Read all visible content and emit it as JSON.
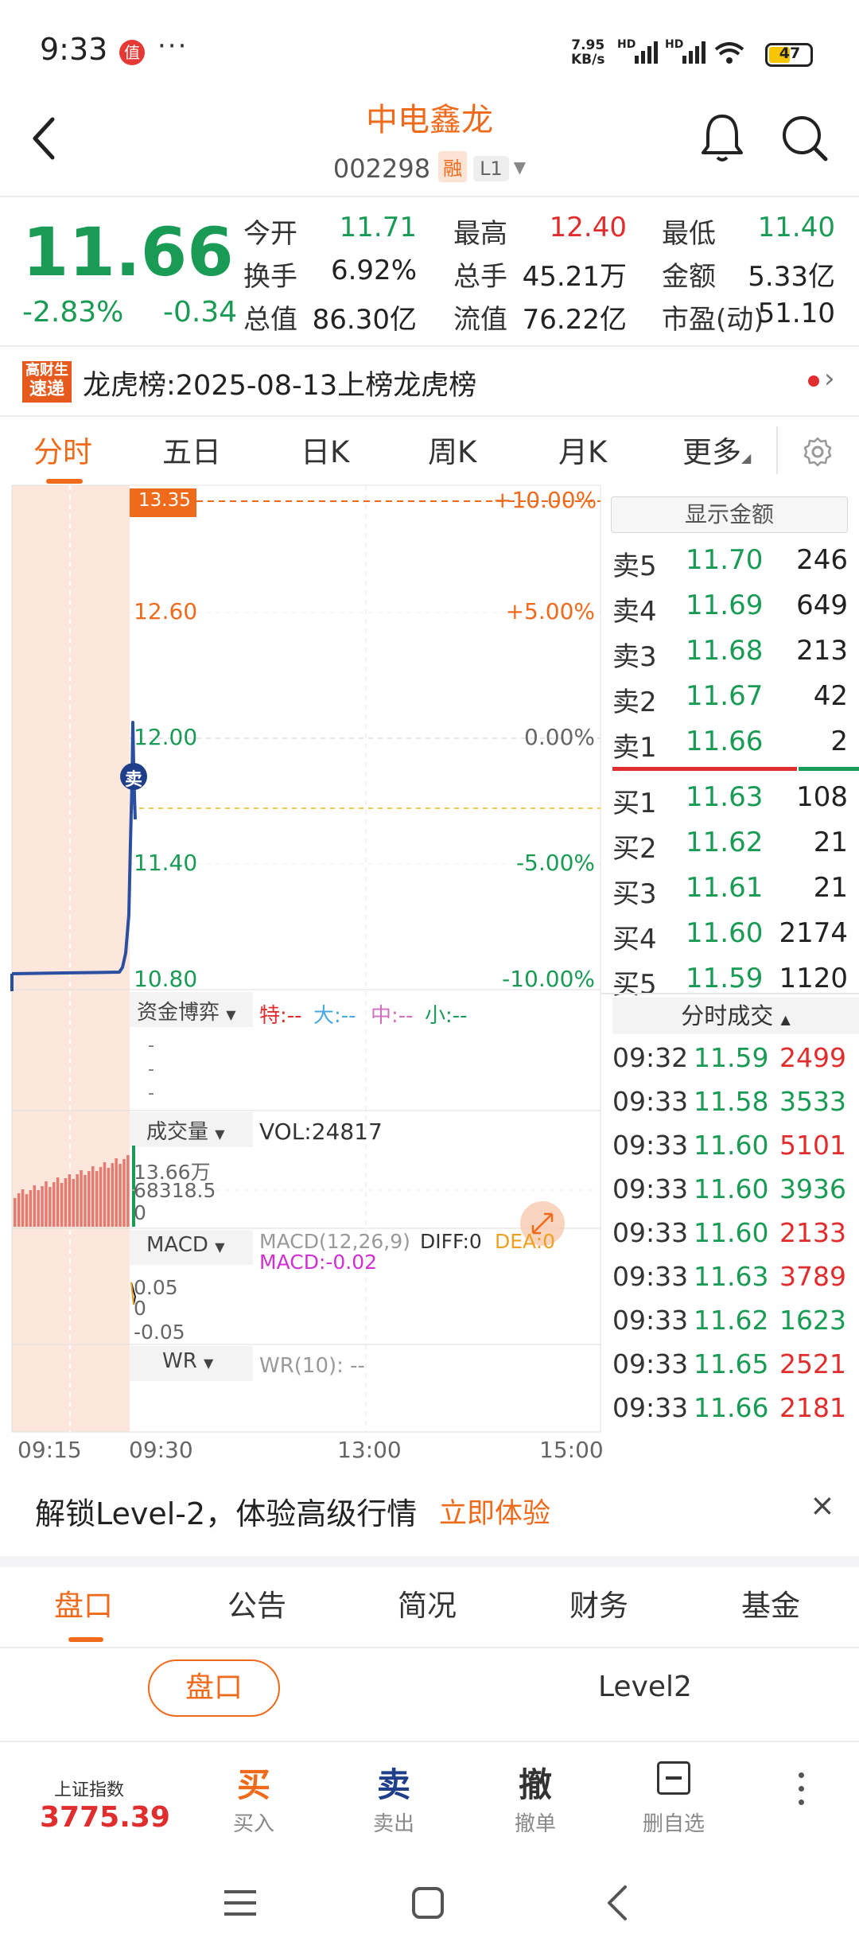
{
  "status_bar": {
    "time": "9:33",
    "badge": "值",
    "dots": "···",
    "net_speed_1": "7.95",
    "net_speed_2": "KB/s",
    "battery": "47"
  },
  "header": {
    "stock_name": "中电鑫龙",
    "stock_code": "002298",
    "tag_margin": "融",
    "tag_level": "L1"
  },
  "quote": {
    "last_price": "11.66",
    "change_pct": "-2.83%",
    "change_val": "-0.34",
    "fields": [
      {
        "label": "今开",
        "value": "11.71",
        "color": "#1a9b55"
      },
      {
        "label": "最高",
        "value": "12.40",
        "color": "#e02d2d"
      },
      {
        "label": "最低",
        "value": "11.40",
        "color": "#1a9b55"
      },
      {
        "label": "换手",
        "value": "6.92%",
        "color": "#222222"
      },
      {
        "label": "总手",
        "value": "45.21万",
        "color": "#222222"
      },
      {
        "label": "金额",
        "value": "5.33亿",
        "color": "#222222"
      },
      {
        "label": "总值",
        "value": "86.30亿",
        "color": "#222222"
      },
      {
        "label": "流值",
        "value": "76.22亿",
        "color": "#222222"
      },
      {
        "label": "市盈(动)",
        "value": "51.10",
        "color": "#222222"
      }
    ]
  },
  "news": {
    "logo_line1": "高财生",
    "logo_line2": "速递",
    "text": "龙虎榜:2025-08-13上榜龙虎榜"
  },
  "period_tabs": [
    "分时",
    "五日",
    "日K",
    "周K",
    "月K",
    "更多"
  ],
  "chart": {
    "price_labels_left": [
      "13.35",
      "12.60",
      "12.00",
      "11.40",
      "10.80"
    ],
    "pct_labels_right": [
      "+10.00%",
      "+5.00%",
      "0.00%",
      "-5.00%",
      "-10.00%"
    ],
    "sell_marker": "卖",
    "fund_panel": {
      "title": "资金博弈",
      "legend_te": "特:--",
      "legend_da": "大:--",
      "legend_zhong": "中:--",
      "legend_xiao": "小:--",
      "dash": "-"
    },
    "volume_panel": {
      "title": "成交量",
      "vol_text": "VOL:24817",
      "axis_top": "13.66万",
      "axis_mid": "68318.5",
      "axis_zero": "0"
    },
    "macd_panel": {
      "title": "MACD",
      "params": "MACD(12,26,9)",
      "diff": "DIFF:0",
      "dea": "DEA:0",
      "macd": "MACD:-0.02",
      "axis_top": "0.05",
      "axis_mid": "0",
      "axis_bottom": "-0.05"
    },
    "wr_panel": {
      "title": "WR",
      "wr_text": "WR(10): --"
    },
    "time_labels": [
      "09:15",
      "09:30",
      "13:00",
      "15:00"
    ]
  },
  "orderbook": {
    "show_amount_label": "显示金额",
    "asks": [
      {
        "label": "卖5",
        "price": "11.70",
        "volume": "246"
      },
      {
        "label": "卖4",
        "price": "11.69",
        "volume": "649"
      },
      {
        "label": "卖3",
        "price": "11.68",
        "volume": "213"
      },
      {
        "label": "卖2",
        "price": "11.67",
        "volume": "42"
      },
      {
        "label": "卖1",
        "price": "11.66",
        "volume": "2"
      }
    ],
    "bids": [
      {
        "label": "买1",
        "price": "11.63",
        "volume": "108"
      },
      {
        "label": "买2",
        "price": "11.62",
        "volume": "21"
      },
      {
        "label": "买3",
        "price": "11.61",
        "volume": "21"
      },
      {
        "label": "买4",
        "price": "11.60",
        "volume": "2174"
      },
      {
        "label": "买5",
        "price": "11.59",
        "volume": "1120"
      }
    ]
  },
  "ticks": {
    "header": "分时成交",
    "rows": [
      {
        "time": "09:32",
        "price": "11.59",
        "volume": "2499",
        "color": "#e02d2d"
      },
      {
        "time": "09:33",
        "price": "11.58",
        "volume": "3533",
        "color": "#1a9b55"
      },
      {
        "time": "09:33",
        "price": "11.60",
        "volume": "5101",
        "color": "#e02d2d"
      },
      {
        "time": "09:33",
        "price": "11.60",
        "volume": "3936",
        "color": "#1a9b55"
      },
      {
        "time": "09:33",
        "price": "11.60",
        "volume": "2133",
        "color": "#e02d2d"
      },
      {
        "time": "09:33",
        "price": "11.63",
        "volume": "3789",
        "color": "#e02d2d"
      },
      {
        "time": "09:33",
        "price": "11.62",
        "volume": "1623",
        "color": "#1a9b55"
      },
      {
        "time": "09:33",
        "price": "11.65",
        "volume": "2521",
        "color": "#e02d2d"
      },
      {
        "time": "09:33",
        "price": "11.66",
        "volume": "2181",
        "color": "#e02d2d"
      }
    ]
  },
  "level2_banner": {
    "text": "解锁Level-2，体验高级行情",
    "cta": "立即体验",
    "close": "×"
  },
  "bottom_tabs": [
    "盘口",
    "公告",
    "简况",
    "财务",
    "基金"
  ],
  "sub_tabs": {
    "active": "盘口",
    "other": "Level2"
  },
  "action_bar": {
    "index_name": "上证指数",
    "index_value": "3775.39",
    "buy_big": "买",
    "buy_small": "买入",
    "sell_big": "卖",
    "sell_small": "卖出",
    "cancel_big": "撤",
    "cancel_small": "撤单",
    "del_small": "删自选"
  },
  "colors": {
    "up": "#e02d2d",
    "down": "#1a9b55",
    "accent": "#f06a1b",
    "line": "#2a4ea0"
  }
}
